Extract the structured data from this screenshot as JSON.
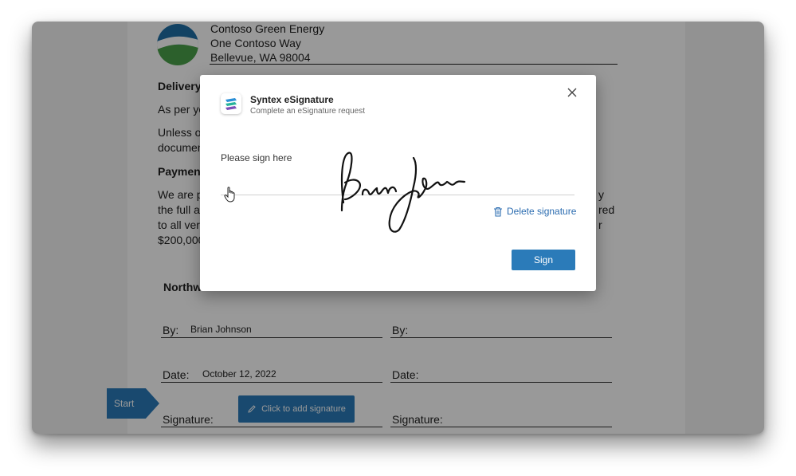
{
  "document": {
    "company_name": "Contoso Green Energy",
    "address_line1": "One Contoso Way",
    "address_line2": "Bellevue, WA  98004",
    "delivery_heading": "Delivery",
    "delivery_text1": "As per yo",
    "unless_line1": "Unless ot",
    "unless_line2": "documen",
    "payment_heading": "Payment",
    "payment_line1": "We are p",
    "payment_line1_tail": "y",
    "payment_line2": "the full a",
    "payment_line2_tail": "red",
    "payment_line3": "to all ver",
    "payment_line3_tail": "r",
    "payment_line4": "$200,000",
    "left_party_heading": "Northw",
    "left_by_label": "By:",
    "left_by_value": "Brian Johnson",
    "left_date_label": "Date:",
    "left_date_value": "October 12, 2022",
    "left_signature_label": "Signature:",
    "right_by_label": "By:",
    "right_date_label": "Date:",
    "right_signature_label": "Signature:",
    "start_tag": "Start",
    "add_signature_button": "Click to add signature"
  },
  "modal": {
    "title": "Syntex eSignature",
    "subtitle": "Complete an eSignature request",
    "prompt": "Please sign here",
    "delete_label": "Delete signature",
    "sign_button": "Sign"
  },
  "colors": {
    "accent": "#2b7bb9",
    "link": "#2b6cb0"
  }
}
